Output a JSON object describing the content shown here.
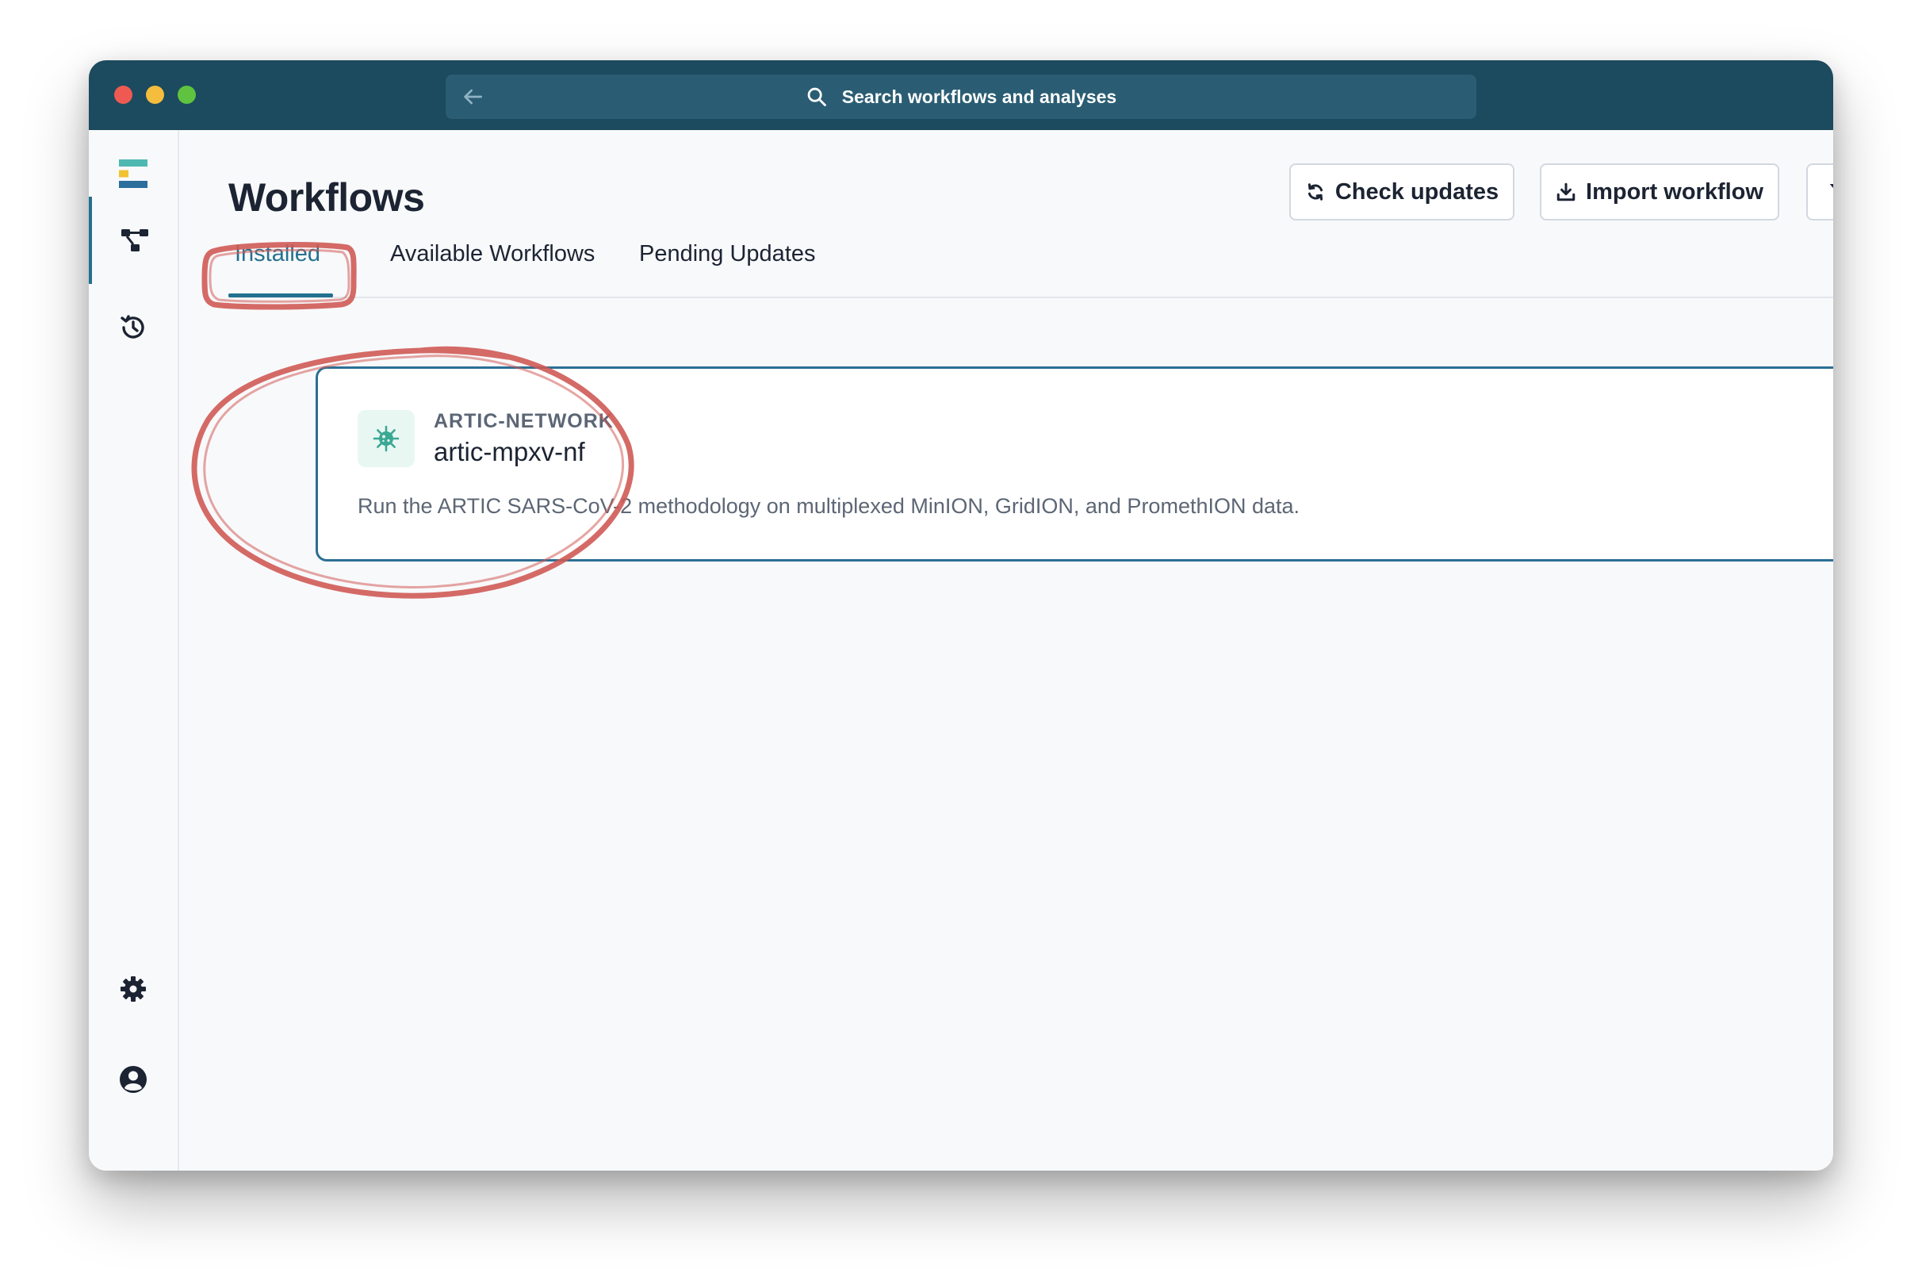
{
  "window": {
    "traffic_lights": [
      "close",
      "minimize",
      "zoom"
    ],
    "colors": {
      "titlebar": "#1c4a5f",
      "searchbar": "#2a5d73",
      "accent": "#23708f",
      "annotation": "#d05a55"
    }
  },
  "search": {
    "back_icon": "arrow-left-icon",
    "icon": "search-icon",
    "placeholder": "Search workflows and analyses"
  },
  "sidebar": {
    "items": [
      {
        "name": "logo",
        "icon": "app-logo-icon"
      },
      {
        "name": "workflows",
        "icon": "workflow-icon",
        "active": true
      },
      {
        "name": "history",
        "icon": "history-icon"
      },
      {
        "name": "settings",
        "icon": "gear-icon"
      },
      {
        "name": "account",
        "icon": "user-circle-icon"
      }
    ]
  },
  "main": {
    "title": "Workflows",
    "buttons": {
      "check_updates": "Check updates",
      "import_workflow": "Import workflow",
      "filter": "filter-icon"
    },
    "tabs": [
      {
        "label": "Installed",
        "active": true
      },
      {
        "label": "Available Workflows",
        "active": false
      },
      {
        "label": "Pending Updates",
        "active": false
      }
    ],
    "workflows": [
      {
        "org": "ARTIC-NETWORK",
        "name": "artic-mpxv-nf",
        "description": "Run the ARTIC SARS-CoV-2 methodology on multiplexed MinION, GridION, and PromethION data.",
        "icon": "virus-icon"
      }
    ]
  }
}
